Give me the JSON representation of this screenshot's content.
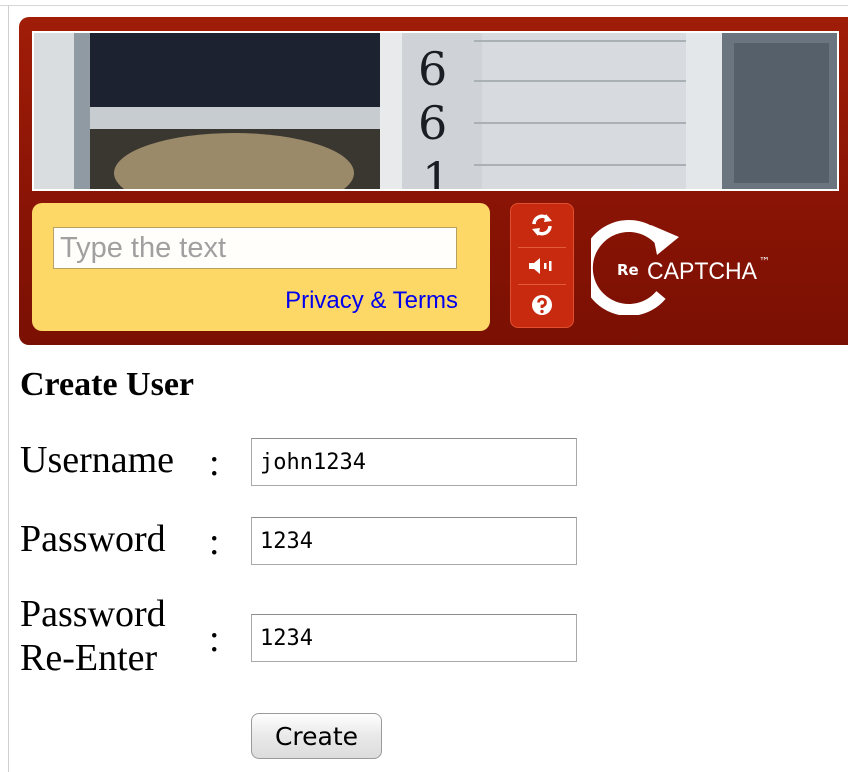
{
  "captcha": {
    "image_text": [
      "6",
      "6",
      "1"
    ],
    "answer_placeholder": "Type the text",
    "answer_value": "",
    "privacy_link": "Privacy & Terms",
    "logo_prefix": "Re",
    "logo_text": "CAPTCHA",
    "logo_tm": "™",
    "controls": [
      {
        "name": "reload",
        "icon": "refresh-icon"
      },
      {
        "name": "audio",
        "icon": "speaker-icon"
      },
      {
        "name": "help",
        "icon": "help-icon"
      }
    ],
    "colors": {
      "widget": "#8a1405",
      "answer_box": "#fdd867",
      "controls": "#c82a10",
      "link": "#0000ee"
    }
  },
  "form": {
    "title": "Create User",
    "colon": ":",
    "username_label": "Username",
    "username_value": "john1234",
    "password_label": "Password",
    "password_value": "1234",
    "reenter_label_line1": "Password",
    "reenter_label_line2": "Re-Enter",
    "reenter_value": "1234",
    "submit_label": "Create"
  }
}
